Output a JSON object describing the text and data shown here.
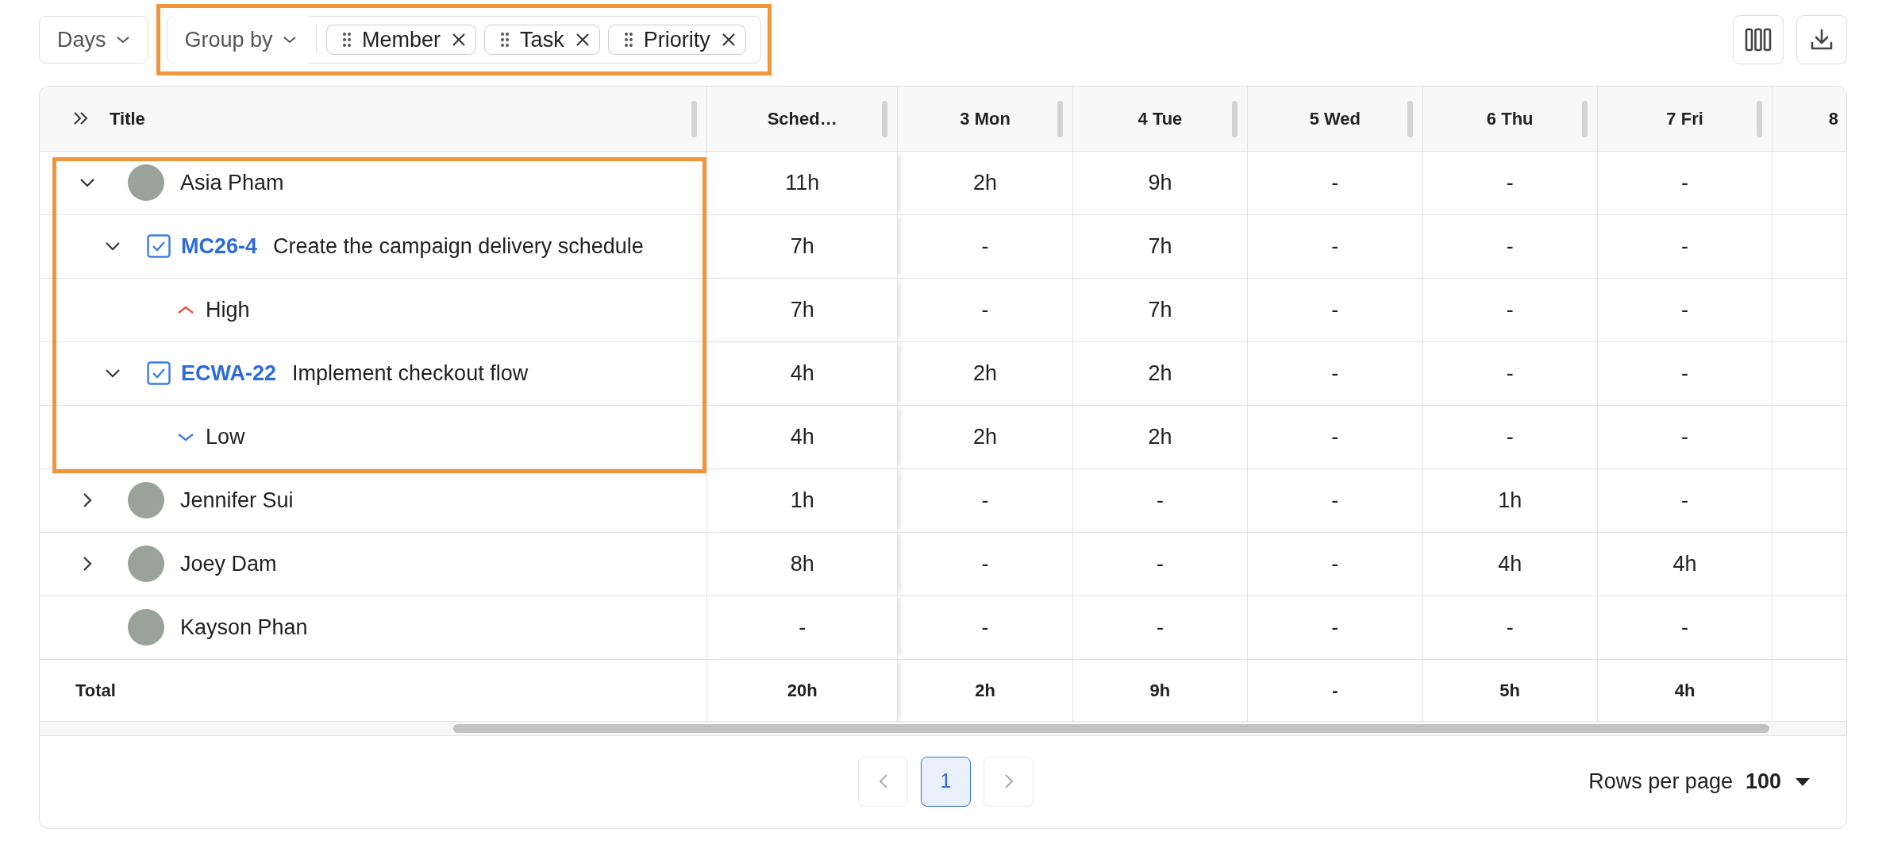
{
  "toolbar": {
    "period": {
      "label": "Days"
    },
    "group_by": {
      "label": "Group by",
      "highlighted": true,
      "chips": [
        {
          "label": "Member"
        },
        {
          "label": "Task"
        },
        {
          "label": "Priority"
        }
      ]
    }
  },
  "table": {
    "columns": [
      {
        "label": "Title"
      },
      {
        "label": "Sched…"
      },
      {
        "label": "3 Mon"
      },
      {
        "label": "4 Tue"
      },
      {
        "label": "5 Wed"
      },
      {
        "label": "6 Thu"
      },
      {
        "label": "7 Fri"
      },
      {
        "label": "8"
      }
    ],
    "rows": [
      {
        "kind": "member",
        "name": "Asia Pham",
        "expanded": true,
        "highlighted": true,
        "values": [
          "11h",
          "2h",
          "9h",
          "-",
          "-",
          "-"
        ],
        "children": [
          {
            "kind": "task",
            "key": "MC26-4",
            "title": "Create the campaign delivery schedule",
            "expanded": true,
            "values": [
              "7h",
              "-",
              "7h",
              "-",
              "-",
              "-"
            ],
            "children": [
              {
                "kind": "priority_high",
                "label": "High",
                "color": "#e5553f",
                "values": [
                  "7h",
                  "-",
                  "7h",
                  "-",
                  "-",
                  "-"
                ]
              }
            ]
          },
          {
            "kind": "task",
            "key": "ECWA-22",
            "title": "Implement checkout flow",
            "expanded": true,
            "values": [
              "4h",
              "2h",
              "2h",
              "-",
              "-",
              "-"
            ],
            "children": [
              {
                "kind": "priority_low",
                "label": "Low",
                "color": "#3b7be8",
                "values": [
                  "4h",
                  "2h",
                  "2h",
                  "-",
                  "-",
                  "-"
                ]
              }
            ]
          }
        ]
      },
      {
        "kind": "member",
        "name": "Jennifer Sui",
        "expanded": false,
        "highlighted": false,
        "values": [
          "1h",
          "-",
          "-",
          "-",
          "1h",
          "-"
        ]
      },
      {
        "kind": "member",
        "name": "Joey Dam",
        "expanded": false,
        "highlighted": false,
        "values": [
          "8h",
          "-",
          "-",
          "-",
          "4h",
          "4h"
        ]
      },
      {
        "kind": "member",
        "name": "Kayson Phan",
        "highlighted": false,
        "values": [
          "-",
          "-",
          "-",
          "-",
          "-",
          "-"
        ]
      }
    ],
    "total": {
      "label": "Total",
      "values": [
        "20h",
        "2h",
        "9h",
        "-",
        "5h",
        "4h"
      ]
    }
  },
  "pagination": {
    "prev": {
      "disabled": true
    },
    "pages": [
      {
        "label": "1",
        "selected": true
      }
    ],
    "next": {
      "disabled": true
    },
    "rows_per_page": {
      "label": "Rows per page",
      "value": "100"
    }
  }
}
